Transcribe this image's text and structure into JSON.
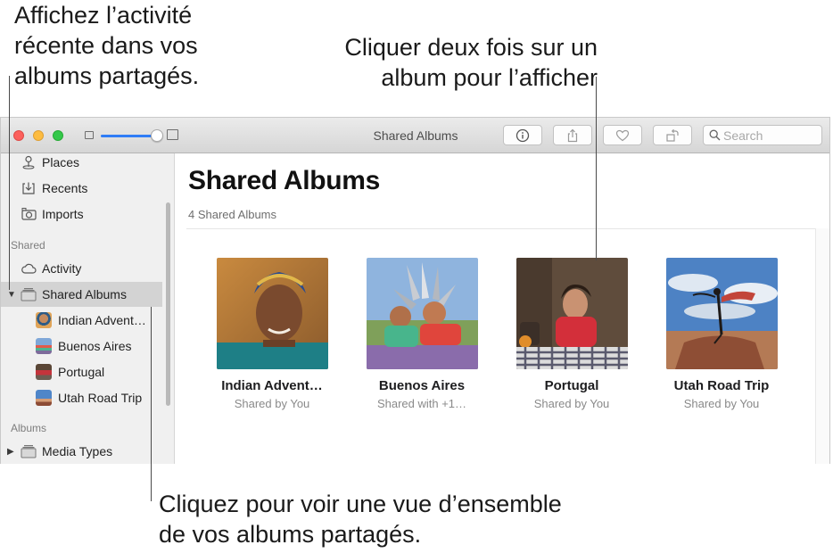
{
  "callouts": {
    "activity": [
      "Affichez l’activité",
      "récente dans vos",
      "albums partagés."
    ],
    "open_album": [
      "Cliquer deux fois sur un",
      "album pour l’afficher"
    ],
    "overview": [
      "Cliquez pour voir une vue d’ensemble",
      "de vos albums partagés."
    ]
  },
  "window": {
    "title": "Shared Albums",
    "zoom_level": 0.95,
    "search": {
      "placeholder": "Search",
      "value": ""
    },
    "toolbar_icons": [
      "info-icon",
      "share-icon",
      "heart-icon",
      "rotate-icon"
    ]
  },
  "sidebar": {
    "top_items": [
      {
        "label": "Places",
        "icon": "pin-icon"
      },
      {
        "label": "Recents",
        "icon": "recents-icon"
      },
      {
        "label": "Imports",
        "icon": "camera-icon"
      }
    ],
    "shared_section": "Shared",
    "activity_label": "Activity",
    "shared_albums_label": "Shared Albums",
    "shared_albums": [
      {
        "label": "Indian Advent…"
      },
      {
        "label": "Buenos Aires"
      },
      {
        "label": "Portugal"
      },
      {
        "label": "Utah Road Trip"
      }
    ],
    "albums_section": "Albums",
    "media_types_label": "Media Types"
  },
  "main": {
    "title": "Shared Albums",
    "subtitle": "4 Shared Albums",
    "albums": [
      {
        "name": "Indian Advent…",
        "owner": "Shared by You"
      },
      {
        "name": "Buenos Aires",
        "owner": "Shared with +1…"
      },
      {
        "name": "Portugal",
        "owner": "Shared by You"
      },
      {
        "name": "Utah Road Trip",
        "owner": "Shared by You"
      }
    ]
  },
  "colors": {
    "accent": "#2f7cf6",
    "sidebar_bg": "#f0f0f0",
    "selection": "#d3d3d3"
  }
}
